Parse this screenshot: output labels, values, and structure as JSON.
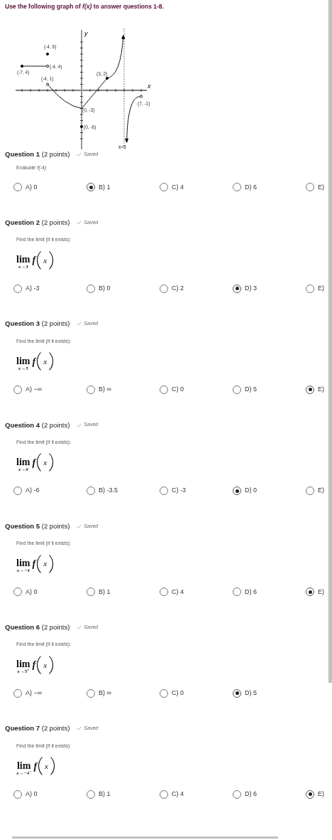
{
  "heading": "Use the following graph of *f(x)* to answer questions 1-8.",
  "graph": {
    "axis_labels": [
      "x",
      "y"
    ],
    "point_labels": [
      "(-4, 6)",
      "(-4, 4)",
      "(-7, 4)",
      "(-4, 1)",
      "(3, 2)",
      "(0, -3)",
      "(0, -6)",
      "(7, -1)"
    ],
    "asymptote_label": "x=5"
  },
  "questions": [
    {
      "title": "Question 1",
      "points": "(2 points)",
      "status": "Saved",
      "prompt": "Evaluate  *f(-4)*",
      "options": [
        {
          "label": "A) 0",
          "selected": false
        },
        {
          "label": "B) 1",
          "selected": true
        },
        {
          "label": "C) 4",
          "selected": false
        },
        {
          "label": "D) 6",
          "selected": false
        },
        {
          "label": "E)",
          "selected": false
        }
      ]
    },
    {
      "title": "Question 2",
      "points": "(2 points)",
      "status": "Saved",
      "prompt": "Find the limit (if it exists):",
      "math": {
        "operator": "lim",
        "subscript": "x→3",
        "function": "f",
        "argument": "x"
      },
      "options": [
        {
          "label": "A) -3",
          "selected": false
        },
        {
          "label": "B) 0",
          "selected": false
        },
        {
          "label": "C) 2",
          "selected": false
        },
        {
          "label": "D) 3",
          "selected": true
        },
        {
          "label": "E)",
          "selected": false
        }
      ]
    },
    {
      "title": "Question 3",
      "points": "(2 points)",
      "status": "Saved",
      "prompt": "Find the limit (if it exists):",
      "math": {
        "operator": "lim",
        "subscript": "x→5",
        "function": "f",
        "argument": "x"
      },
      "options": [
        {
          "label": "A) −∞",
          "selected": false
        },
        {
          "label": "B) ∞",
          "selected": false
        },
        {
          "label": "C) 0",
          "selected": false
        },
        {
          "label": "D) 5",
          "selected": false
        },
        {
          "label": "E)",
          "selected": true
        }
      ]
    },
    {
      "title": "Question 4",
      "points": "(2 points)",
      "status": "Saved",
      "prompt": "Find the limit (if it exists):",
      "math": {
        "operator": "lim",
        "subscript": "x→0",
        "function": "f",
        "argument": "x"
      },
      "options": [
        {
          "label": "A) -6",
          "selected": false
        },
        {
          "label": "B) -3.5",
          "selected": false
        },
        {
          "label": "C) -3",
          "selected": false
        },
        {
          "label": "D) 0",
          "selected": true
        },
        {
          "label": "E)",
          "selected": false
        }
      ]
    },
    {
      "title": "Question 5",
      "points": "(2 points)",
      "status": "Saved",
      "prompt": "Find the limit (if it exists):",
      "math": {
        "operator": "lim",
        "subscript": "x→−4",
        "function": "f",
        "argument": "x"
      },
      "options": [
        {
          "label": "A) 0",
          "selected": false
        },
        {
          "label": "B) 1",
          "selected": false
        },
        {
          "label": "C) 4",
          "selected": false
        },
        {
          "label": "D) 6",
          "selected": false
        },
        {
          "label": "E)",
          "selected": true
        }
      ]
    },
    {
      "title": "Question 6",
      "points": "(2 points)",
      "status": "Saved",
      "prompt": "Find the limit (if it exists):",
      "math": {
        "operator": "lim",
        "subscript": "x→5$^{+}$",
        "function": "f",
        "argument": "x"
      },
      "options": [
        {
          "label": "A) −∞",
          "selected": false
        },
        {
          "label": "B) ∞",
          "selected": false
        },
        {
          "label": "C) 0",
          "selected": false
        },
        {
          "label": "D) 5",
          "selected": true
        }
      ]
    },
    {
      "title": "Question 7",
      "points": "(2 points)",
      "status": "Saved",
      "prompt": "Find the limit (if it exists):",
      "math": {
        "operator": "lim",
        "subscript": "x→−4$^{−}$",
        "function": "f",
        "argument": "x"
      },
      "options": [
        {
          "label": "A) 0",
          "selected": false
        },
        {
          "label": "B) 1",
          "selected": false
        },
        {
          "label": "C) 4",
          "selected": false
        },
        {
          "label": "D) 6",
          "selected": false
        },
        {
          "label": "E)",
          "selected": true
        }
      ]
    }
  ]
}
